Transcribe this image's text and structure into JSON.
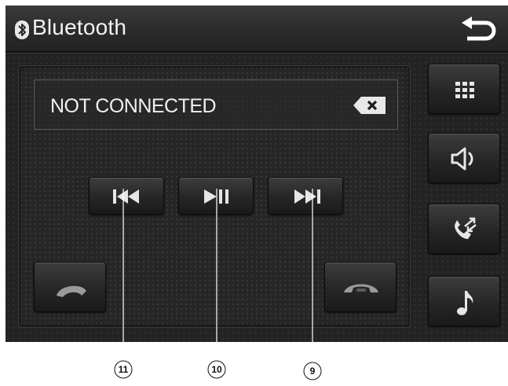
{
  "header": {
    "title": "Bluetooth",
    "bluetooth_icon": "bluetooth-icon",
    "back_icon": "back-arrow-icon"
  },
  "status": {
    "text": "NOT CONNECTED",
    "clear_icon": "backspace-icon"
  },
  "media_controls": [
    {
      "name": "previous-track",
      "icon": "skip-previous-icon"
    },
    {
      "name": "play-pause",
      "icon": "play-pause-icon"
    },
    {
      "name": "next-track",
      "icon": "skip-next-icon"
    }
  ],
  "call_controls": {
    "answer_icon": "phone-answer-icon",
    "hangup_icon": "phone-hangup-icon"
  },
  "side_menu": [
    {
      "name": "keypad",
      "icon": "keypad-icon"
    },
    {
      "name": "speaker",
      "icon": "speaker-icon"
    },
    {
      "name": "call-transfer",
      "icon": "call-transfer-icon"
    },
    {
      "name": "music",
      "icon": "music-note-icon"
    }
  ],
  "callouts": [
    "11",
    "10",
    "9"
  ],
  "colors": {
    "screen_background": "#232323",
    "icon": "#e6e6e6",
    "text": "#f0f0f0"
  }
}
